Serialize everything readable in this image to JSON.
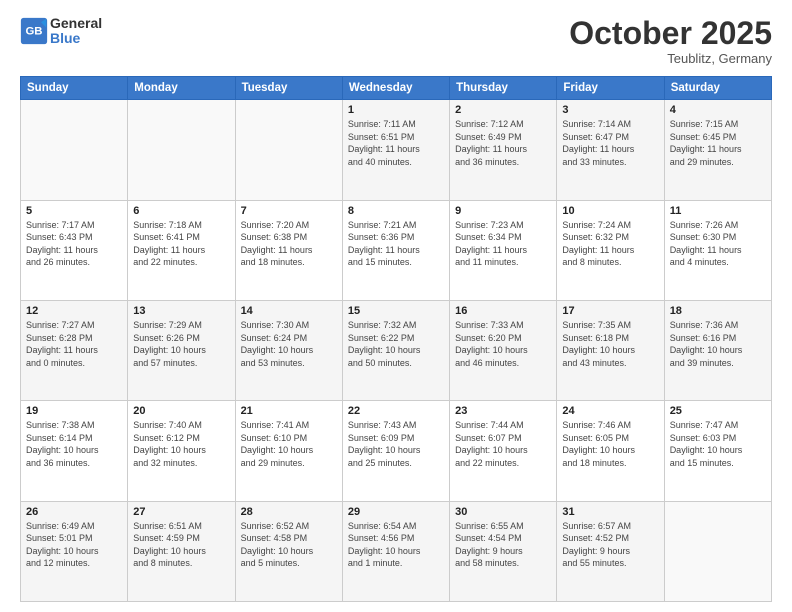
{
  "header": {
    "logo_line1": "General",
    "logo_line2": "Blue",
    "month_title": "October 2025",
    "location": "Teublitz, Germany"
  },
  "days_of_week": [
    "Sunday",
    "Monday",
    "Tuesday",
    "Wednesday",
    "Thursday",
    "Friday",
    "Saturday"
  ],
  "weeks": [
    [
      {
        "day": "",
        "info": ""
      },
      {
        "day": "",
        "info": ""
      },
      {
        "day": "",
        "info": ""
      },
      {
        "day": "1",
        "info": "Sunrise: 7:11 AM\nSunset: 6:51 PM\nDaylight: 11 hours\nand 40 minutes."
      },
      {
        "day": "2",
        "info": "Sunrise: 7:12 AM\nSunset: 6:49 PM\nDaylight: 11 hours\nand 36 minutes."
      },
      {
        "day": "3",
        "info": "Sunrise: 7:14 AM\nSunset: 6:47 PM\nDaylight: 11 hours\nand 33 minutes."
      },
      {
        "day": "4",
        "info": "Sunrise: 7:15 AM\nSunset: 6:45 PM\nDaylight: 11 hours\nand 29 minutes."
      }
    ],
    [
      {
        "day": "5",
        "info": "Sunrise: 7:17 AM\nSunset: 6:43 PM\nDaylight: 11 hours\nand 26 minutes."
      },
      {
        "day": "6",
        "info": "Sunrise: 7:18 AM\nSunset: 6:41 PM\nDaylight: 11 hours\nand 22 minutes."
      },
      {
        "day": "7",
        "info": "Sunrise: 7:20 AM\nSunset: 6:38 PM\nDaylight: 11 hours\nand 18 minutes."
      },
      {
        "day": "8",
        "info": "Sunrise: 7:21 AM\nSunset: 6:36 PM\nDaylight: 11 hours\nand 15 minutes."
      },
      {
        "day": "9",
        "info": "Sunrise: 7:23 AM\nSunset: 6:34 PM\nDaylight: 11 hours\nand 11 minutes."
      },
      {
        "day": "10",
        "info": "Sunrise: 7:24 AM\nSunset: 6:32 PM\nDaylight: 11 hours\nand 8 minutes."
      },
      {
        "day": "11",
        "info": "Sunrise: 7:26 AM\nSunset: 6:30 PM\nDaylight: 11 hours\nand 4 minutes."
      }
    ],
    [
      {
        "day": "12",
        "info": "Sunrise: 7:27 AM\nSunset: 6:28 PM\nDaylight: 11 hours\nand 0 minutes."
      },
      {
        "day": "13",
        "info": "Sunrise: 7:29 AM\nSunset: 6:26 PM\nDaylight: 10 hours\nand 57 minutes."
      },
      {
        "day": "14",
        "info": "Sunrise: 7:30 AM\nSunset: 6:24 PM\nDaylight: 10 hours\nand 53 minutes."
      },
      {
        "day": "15",
        "info": "Sunrise: 7:32 AM\nSunset: 6:22 PM\nDaylight: 10 hours\nand 50 minutes."
      },
      {
        "day": "16",
        "info": "Sunrise: 7:33 AM\nSunset: 6:20 PM\nDaylight: 10 hours\nand 46 minutes."
      },
      {
        "day": "17",
        "info": "Sunrise: 7:35 AM\nSunset: 6:18 PM\nDaylight: 10 hours\nand 43 minutes."
      },
      {
        "day": "18",
        "info": "Sunrise: 7:36 AM\nSunset: 6:16 PM\nDaylight: 10 hours\nand 39 minutes."
      }
    ],
    [
      {
        "day": "19",
        "info": "Sunrise: 7:38 AM\nSunset: 6:14 PM\nDaylight: 10 hours\nand 36 minutes."
      },
      {
        "day": "20",
        "info": "Sunrise: 7:40 AM\nSunset: 6:12 PM\nDaylight: 10 hours\nand 32 minutes."
      },
      {
        "day": "21",
        "info": "Sunrise: 7:41 AM\nSunset: 6:10 PM\nDaylight: 10 hours\nand 29 minutes."
      },
      {
        "day": "22",
        "info": "Sunrise: 7:43 AM\nSunset: 6:09 PM\nDaylight: 10 hours\nand 25 minutes."
      },
      {
        "day": "23",
        "info": "Sunrise: 7:44 AM\nSunset: 6:07 PM\nDaylight: 10 hours\nand 22 minutes."
      },
      {
        "day": "24",
        "info": "Sunrise: 7:46 AM\nSunset: 6:05 PM\nDaylight: 10 hours\nand 18 minutes."
      },
      {
        "day": "25",
        "info": "Sunrise: 7:47 AM\nSunset: 6:03 PM\nDaylight: 10 hours\nand 15 minutes."
      }
    ],
    [
      {
        "day": "26",
        "info": "Sunrise: 6:49 AM\nSunset: 5:01 PM\nDaylight: 10 hours\nand 12 minutes."
      },
      {
        "day": "27",
        "info": "Sunrise: 6:51 AM\nSunset: 4:59 PM\nDaylight: 10 hours\nand 8 minutes."
      },
      {
        "day": "28",
        "info": "Sunrise: 6:52 AM\nSunset: 4:58 PM\nDaylight: 10 hours\nand 5 minutes."
      },
      {
        "day": "29",
        "info": "Sunrise: 6:54 AM\nSunset: 4:56 PM\nDaylight: 10 hours\nand 1 minute."
      },
      {
        "day": "30",
        "info": "Sunrise: 6:55 AM\nSunset: 4:54 PM\nDaylight: 9 hours\nand 58 minutes."
      },
      {
        "day": "31",
        "info": "Sunrise: 6:57 AM\nSunset: 4:52 PM\nDaylight: 9 hours\nand 55 minutes."
      },
      {
        "day": "",
        "info": ""
      }
    ]
  ]
}
